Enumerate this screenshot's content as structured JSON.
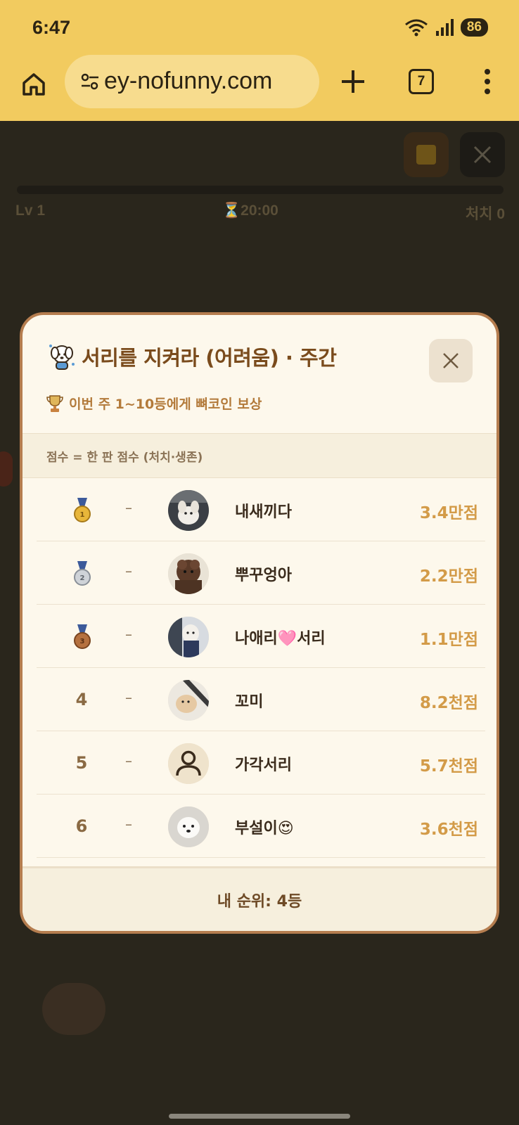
{
  "status_bar": {
    "time": "6:47",
    "battery": "86"
  },
  "browser": {
    "url": "ey-nofunny.com",
    "tab_count": "7"
  },
  "hud": {
    "level": "Lv 1",
    "timer": "⏳20:00",
    "kills": "처치 0"
  },
  "modal": {
    "title": "서리를 지켜라 (어려움) · 주간",
    "reward": "이번 주 1~10등에게 뼈코인 보상",
    "score_note": "점수 = 한 판 점수 (처치·생존)",
    "my_rank": "내 순위: 4등",
    "rows": [
      {
        "rank": "1",
        "medal": "gold",
        "change": "–",
        "name": "내새끼다",
        "score": "3.4만점"
      },
      {
        "rank": "2",
        "medal": "silver",
        "change": "–",
        "name": "뿌꾸엉아",
        "score": "2.2만점"
      },
      {
        "rank": "3",
        "medal": "bronze",
        "change": "–",
        "name": "나애리🩷서리",
        "score": "1.1만점"
      },
      {
        "rank": "4",
        "medal": "",
        "change": "–",
        "name": "꼬미",
        "score": "8.2천점"
      },
      {
        "rank": "5",
        "medal": "",
        "change": "–",
        "name": "가각서리",
        "score": "5.7천점"
      },
      {
        "rank": "6",
        "medal": "",
        "change": "–",
        "name": "부설이😍",
        "score": "3.6천점"
      }
    ]
  },
  "colors": {
    "accent": "#f2cb5f",
    "score": "#d39b48",
    "modal_border": "#b57d4f"
  },
  "icons": [
    "home-icon",
    "tune-icon",
    "plus-icon",
    "more-vert-icon",
    "pause-icon",
    "close-icon",
    "dog-mascot-icon",
    "trophy-icon",
    "medal-icon",
    "person-icon"
  ]
}
